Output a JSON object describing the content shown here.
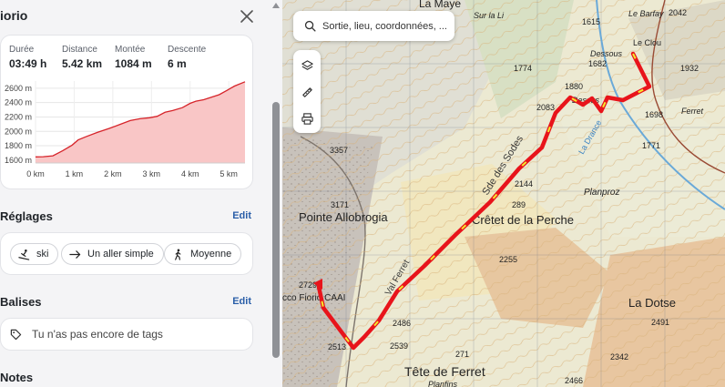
{
  "panel": {
    "title": "iorio",
    "stats": [
      {
        "label": "Durée",
        "value": "03:49 h"
      },
      {
        "label": "Distance",
        "value": "5.42 km"
      },
      {
        "label": "Montée",
        "value": "1084 m"
      },
      {
        "label": "Descente",
        "value": "6 m"
      }
    ],
    "settings": {
      "title": "Réglages",
      "edit": "Edit",
      "chips": [
        {
          "icon": "ski-icon",
          "label": "ski"
        },
        {
          "icon": "arrow-right-icon",
          "label": "Un aller simple"
        },
        {
          "icon": "hiker-icon",
          "label": "Moyenne"
        }
      ]
    },
    "tags": {
      "title": "Balises",
      "edit": "Edit",
      "empty_text": "Tu n'as pas encore de tags"
    },
    "notes": {
      "title": "Notes"
    }
  },
  "chart_data": {
    "type": "area",
    "x_unit": "km",
    "y_unit": "m",
    "x_ticks": [
      "0 km",
      "1 km",
      "2 km",
      "3 km",
      "4 km",
      "5 km"
    ],
    "y_ticks": [
      "1600 m",
      "1800 m",
      "2000 m",
      "2200 m",
      "2400 m",
      "2600 m"
    ],
    "xlim": [
      0,
      5.42
    ],
    "ylim": [
      1560,
      2700
    ],
    "grid": true,
    "fill_color": "#f9c6c6",
    "line_color": "#d6242a",
    "x": [
      0,
      0.2,
      0.45,
      0.7,
      0.95,
      1.1,
      1.3,
      1.6,
      1.9,
      2.2,
      2.45,
      2.7,
      2.95,
      3.15,
      3.35,
      3.55,
      3.8,
      4.0,
      4.15,
      4.35,
      4.55,
      4.75,
      4.95,
      5.15,
      5.42
    ],
    "y": [
      1645,
      1648,
      1660,
      1730,
      1810,
      1880,
      1925,
      1985,
      2040,
      2100,
      2150,
      2175,
      2190,
      2210,
      2265,
      2290,
      2330,
      2390,
      2420,
      2440,
      2475,
      2510,
      2570,
      2630,
      2690
    ]
  },
  "map": {
    "search_placeholder": "Sortie, lieu, coordonnées, ...",
    "tools": [
      "layers-icon",
      "ruler-icon",
      "print-icon"
    ],
    "route_color": "#e8141b",
    "route_highlight": "#f5e92a",
    "labels": {
      "la_maye": "La Maye",
      "le_barfay": "Le Barfay",
      "e2042": "2042",
      "le_clou": "Le Clou",
      "e1615": "1615",
      "dessous": "Dessous",
      "e1682": "1682",
      "e1932": "1932",
      "e1774": "1774",
      "e1880": "1880",
      "dessus": "Dessus",
      "e2083": "2083",
      "e1698": "1698",
      "ferret_village": "Ferret",
      "e1771": "1771",
      "sur_la_li": "Sur la Li",
      "e3357": "3357",
      "e2144": "2144",
      "planproz": "Planproz",
      "e3171": "3171",
      "pointe_allobrogia": "Pointe Allobrogia",
      "cretet": "Crêtet de la Perche",
      "e2289": "289",
      "e2255": "2255",
      "la_dotse": "La Dotse",
      "e2729": "2729",
      "fiorio": "cco Fiorio CAAI",
      "e2491": "2491",
      "e2486": "2486",
      "e2513": "2513",
      "e2539": "2539",
      "tete_de_ferret": "Tête de Ferret",
      "e2466": "2466",
      "planfins": "Planfins",
      "e271": "271",
      "la_drance": "La Drance",
      "des_sodes": "Sde des Sodes",
      "val_ferret": "Val Ferret",
      "e2342": "2342"
    }
  }
}
